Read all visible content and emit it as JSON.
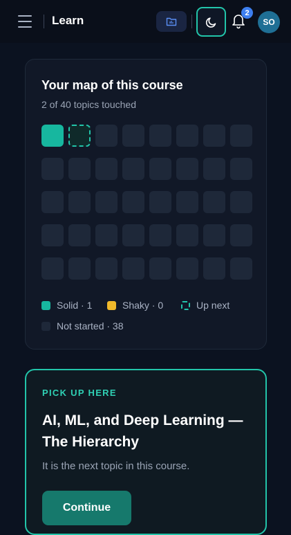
{
  "header": {
    "title": "Learn",
    "notification_count": "2",
    "avatar_initials": "SO",
    "icons": [
      "menu-icon",
      "folder-icon",
      "moon-icon",
      "bell-icon"
    ]
  },
  "course_map": {
    "title": "Your map of this course",
    "subtitle": "2 of 40 topics touched",
    "total_topics": 40,
    "cell_states": [
      "solid",
      "next",
      "none",
      "none",
      "none",
      "none",
      "none",
      "none",
      "none",
      "none",
      "none",
      "none",
      "none",
      "none",
      "none",
      "none",
      "none",
      "none",
      "none",
      "none",
      "none",
      "none",
      "none",
      "none",
      "none",
      "none",
      "none",
      "none",
      "none",
      "none",
      "none",
      "none",
      "none",
      "none",
      "none",
      "none",
      "none",
      "none",
      "none",
      "none"
    ],
    "legend": {
      "solid": "Solid · 1",
      "shaky": "Shaky · 0",
      "next": "Up next",
      "not_started": "Not started · 38"
    }
  },
  "resume": {
    "eyebrow": "PICK UP HERE",
    "title": "AI, ML, and Deep Learning — The Hierarchy",
    "description": "It is the next topic in this course.",
    "button_label": "Continue"
  },
  "colors": {
    "accent": "#22c5aa",
    "solid": "#17b79f",
    "shaky": "#f0b92b",
    "not_started": "#1e2839",
    "badge": "#3d7ff0"
  }
}
